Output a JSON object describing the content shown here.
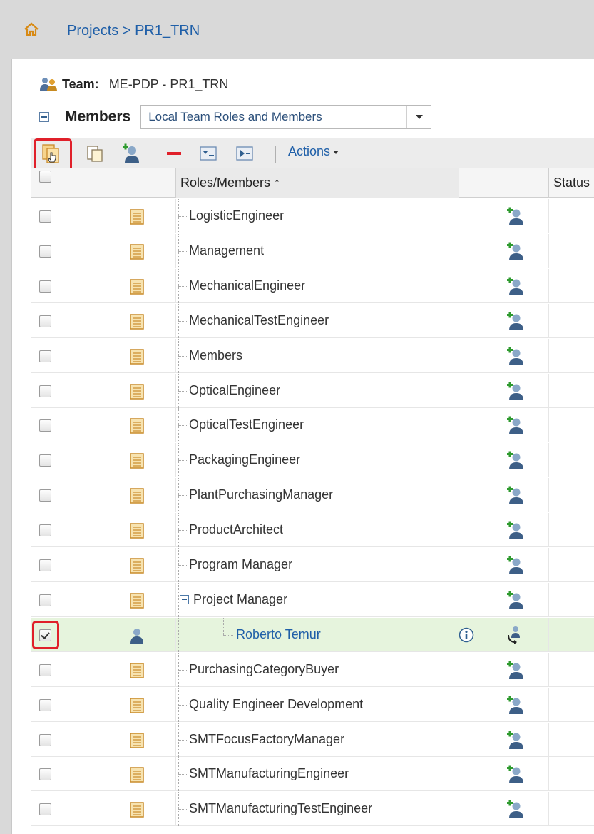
{
  "breadcrumb": {
    "root": "Projects",
    "separator": ">",
    "current": "PR1_TRN"
  },
  "team": {
    "label": "Team:",
    "value": "ME-PDP - PR1_TRN"
  },
  "members": {
    "label": "Members",
    "view_select": {
      "selected": "Local Team Roles and Members"
    }
  },
  "toolbar": {
    "actions_label": "Actions",
    "icons": [
      "add-role-icon",
      "paste-icon",
      "add-member-icon",
      "remove-icon",
      "filter-icon",
      "expand-icon"
    ]
  },
  "table": {
    "columns": {
      "roles": "Roles/Members ↑",
      "status": "Status"
    },
    "rows": [
      {
        "label": "LogisticEngineer",
        "type": "role",
        "checked": false
      },
      {
        "label": "Management",
        "type": "role",
        "checked": false
      },
      {
        "label": "MechanicalEngineer",
        "type": "role",
        "checked": false
      },
      {
        "label": "MechanicalTestEngineer",
        "type": "role",
        "checked": false
      },
      {
        "label": "Members",
        "type": "role",
        "checked": false
      },
      {
        "label": "OpticalEngineer",
        "type": "role",
        "checked": false
      },
      {
        "label": "OpticalTestEngineer",
        "type": "role",
        "checked": false
      },
      {
        "label": "PackagingEngineer",
        "type": "role",
        "checked": false
      },
      {
        "label": "PlantPurchasingManager",
        "type": "role",
        "checked": false
      },
      {
        "label": "ProductArchitect",
        "type": "role",
        "checked": false
      },
      {
        "label": "Program Manager",
        "type": "role",
        "checked": false
      },
      {
        "label": "Project Manager",
        "type": "role-expanded",
        "checked": false
      },
      {
        "label": "Roberto Temur",
        "type": "member",
        "checked": true
      },
      {
        "label": "PurchasingCategoryBuyer",
        "type": "role",
        "checked": false
      },
      {
        "label": "Quality Engineer Development",
        "type": "role",
        "checked": false
      },
      {
        "label": "SMTFocusFactoryManager",
        "type": "role",
        "checked": false
      },
      {
        "label": "SMTManufacturingEngineer",
        "type": "role",
        "checked": false
      },
      {
        "label": "SMTManufacturingTestEngineer",
        "type": "role",
        "checked": false
      }
    ]
  },
  "colors": {
    "link": "#1f5fa8",
    "highlight": "#e0202a",
    "selected_row": "#e6f4dd",
    "role_icon": "#d9a441"
  }
}
